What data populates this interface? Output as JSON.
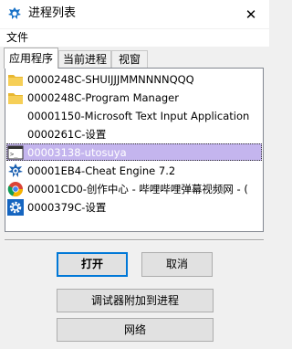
{
  "window": {
    "title": "进程列表",
    "close_glyph": "✕"
  },
  "menu": {
    "file": "文件"
  },
  "tabs": [
    {
      "label": "应用程序",
      "active": true
    },
    {
      "label": "当前进程",
      "active": false
    },
    {
      "label": "视窗",
      "active": false
    }
  ],
  "processes": [
    {
      "label": "0000248C-SHUIJJJMMNNNNQQQ",
      "icon": "folder-icon",
      "selected": false
    },
    {
      "label": "0000248C-Program Manager",
      "icon": "folder-icon",
      "selected": false
    },
    {
      "label": "00001150-Microsoft Text Input Application",
      "icon": "none",
      "selected": false
    },
    {
      "label": "0000261C-设置",
      "icon": "none",
      "selected": false
    },
    {
      "label": "00003138-utosuya",
      "icon": "console-icon",
      "selected": true
    },
    {
      "label": "00001EB4-Cheat Engine 7.2",
      "icon": "cheat-engine-icon",
      "selected": false
    },
    {
      "label": "00001CD0-创作中心 - 哔哩哔哩弹幕视频网 - (",
      "icon": "chrome-icon",
      "selected": false
    },
    {
      "label": "0000379C-设置",
      "icon": "settings-gear-icon",
      "selected": false
    }
  ],
  "buttons": {
    "open": "打开",
    "cancel": "取消",
    "attach": "调试器附加到进程",
    "network": "网络"
  },
  "colors": {
    "selection": "#c4b5ee",
    "default_button_border": "#0078d7",
    "accent": "#0078d7"
  }
}
